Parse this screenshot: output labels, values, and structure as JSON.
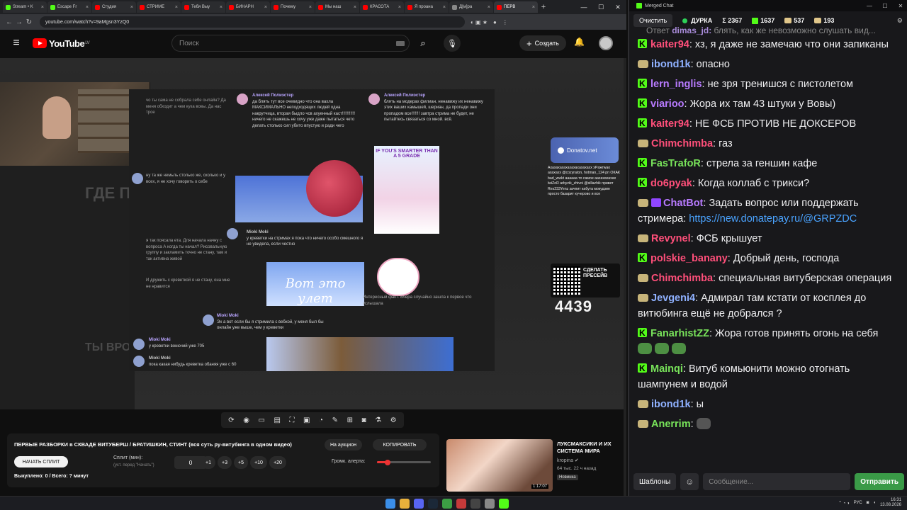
{
  "browser": {
    "tabs": [
      {
        "label": "Stream • K",
        "color": "#53fc18"
      },
      {
        "label": "Escape Fr",
        "color": "#53fc18"
      },
      {
        "label": "Студия",
        "color": "#ff0000"
      },
      {
        "label": "СТРИМЕ",
        "color": "#ff0000"
      },
      {
        "label": "Тебя Выу",
        "color": "#ff0000"
      },
      {
        "label": "БИНАРН",
        "color": "#ff0000"
      },
      {
        "label": "Почему",
        "color": "#ff0000"
      },
      {
        "label": "Мы наш",
        "color": "#ff0000"
      },
      {
        "label": "КРАСОТА",
        "color": "#ff0000"
      },
      {
        "label": "Я проана",
        "color": "#ff0000"
      },
      {
        "label": "Д[м]ра",
        "color": "#888888"
      },
      {
        "label": "ПЕРВ",
        "color": "#ff0000"
      }
    ],
    "url": "youtube.com/watch?v=9aMgsn3YzQ0"
  },
  "youtube": {
    "logo": "YouTube",
    "region": "LV",
    "search_placeholder": "Поиск",
    "create_label": "Создать"
  },
  "video": {
    "screen_msgs": {
      "name1": "Алексей Полиэстер",
      "msg1": "да блять тут все очевидно что она вахла МАКСИМАЛЬНО неподходящих людей одна накрутчица, вторая быдло чсв ахуенный каст!!!!!!!!!!! ничего не скажешь не хочу уже даже пытаться чето делать столько сил убито впустую и ради чего",
      "name2": "Алексей Полиэстер",
      "msg2": "блять на модерах филиан, ненавижу их ненавижу этих ваших камышей, шериан, да пропади они пропадом все!!!!!!! завтра стрима не будет, не пытайтесь связаться со мной. всё.",
      "name3": "Mioki Moki",
      "msg3": "у креветки на стримах я пока что ничего особо смешного я не увидела, если честно",
      "name4": "Mioki Moki",
      "msg4": "Эх а вот если бы я стримила с вебкой, у меня был бы онлайн уже выше, чем у креветки",
      "name5": "Mioki Moki",
      "msg5": "у креветки вонючий уже 705",
      "name6": "Mioki Moki",
      "msg6": "пока какая нибудь креветка обаняя уже с 60",
      "meme": "Вот это улет",
      "poster": "IF YOU'S SMARTER THAN A 5 GRADE"
    },
    "bg_text1": "ГДЕ ПАРЕ",
    "bg_text2": "ТЫ ВРОДИ",
    "donate_label": "Donatov.net",
    "alerts": "Ахахахахахахахахахахахх хPaжгwaо ахахахх @cozyraton, hotman_124 рп ОКАК bad_wwkt аааааа то самое аахахахахах lwiZoR arbyzik_zhivoi @sillazhik привет Res233Yenz зачпит кабута мокудзин просто базарит кучерово и все",
    "qr_text": "СДЕЛАТЬ ПРЕСЕЙВ",
    "counter": "4439"
  },
  "panel": {
    "title": "ПЕРВЫЕ РАЗБОРКИ в СКВАДЕ ВИТУБЕРШ / БРАТИШКИН, СТИНТ (вся суть ру-витубинга в одном видео)",
    "auction_btn": "На аукцион",
    "copy_btn": "КОПИРОВАТЬ",
    "start_btn": "НАЧАТЬ СПЛИТ",
    "split_label": "Сплит (мин):",
    "split_hint": "(уст. перед \"Начать\")",
    "split_value": "0",
    "increments": [
      "+1",
      "+3",
      "+5",
      "+10",
      "+20"
    ],
    "volume_label": "Громк. алерта:",
    "volume_level": 0.2,
    "bought": "Выкуплено: 0 / Всего: ? минут"
  },
  "recommend": {
    "title": "ЛУКСМАКСИКИ И ИХ СИСТЕМА МИРА",
    "channel": "kropina",
    "meta": "64 тыс.  22 ч назад",
    "badge": "Новинка",
    "duration": "1:17:07"
  },
  "chat": {
    "window_title": "Merged Chat",
    "clear": "Очистить",
    "stats": {
      "status": "ДУРКА",
      "sum": "Σ 2367",
      "kick": "1637",
      "twitch": "537",
      "other": "193"
    },
    "reply_prefix": "Ответ",
    "reply_user": "dimas_jd:",
    "reply_text": "блять, как же невозможно слушать вид...",
    "messages": [
      {
        "src": "kick",
        "user": "kaiter94",
        "color": "#ff4f7a",
        "text": "хз, я даже не замечаю что они запиканы"
      },
      {
        "src": "tw",
        "user": "ibond1k",
        "color": "#8fb1ff",
        "text": "опасно"
      },
      {
        "src": "kick",
        "user": "lern_inglis",
        "color": "#b87bff",
        "text": "не зря тренишся с пистолетом"
      },
      {
        "src": "kick",
        "user": "viarioo",
        "color": "#b87bff",
        "text": "Жора их там 43 штуки у Вовы)"
      },
      {
        "src": "kick",
        "user": "kaiter94",
        "color": "#ff4f7a",
        "text": "НЕ ФСБ ПРОТИВ НЕ ДОКСЕРОВ"
      },
      {
        "src": "tw",
        "user": "Chimchimba",
        "color": "#ff4f7a",
        "text": "газ"
      },
      {
        "src": "kick",
        "user": "FasTrafoR",
        "color": "#78e35a",
        "text": "стрела за геншин кафе"
      },
      {
        "src": "kick",
        "user": "do6pyak",
        "color": "#ff4f7a",
        "text": "Когда коллаб с трикси?"
      },
      {
        "src": "bot",
        "user": "ChatBot",
        "color": "#b87bff",
        "text": "Задать вопрос или поддержать стримера: ",
        "link": "https://new.donatepay.ru/@GRPZDC"
      },
      {
        "src": "tw",
        "user": "Revynel",
        "color": "#ff4f7a",
        "text": "ФСБ крышует"
      },
      {
        "src": "kick",
        "user": "polskie_banany",
        "color": "#ff4f7a",
        "text": "Добрый день, господа"
      },
      {
        "src": "tw",
        "user": "Chimchimba",
        "color": "#ff4f7a",
        "text": "специальная витуберская операция"
      },
      {
        "src": "tw",
        "user": "Jevgeni4",
        "color": "#8fb1ff",
        "text": "Адмирал там кстати от косплея до витюбинга ещё не добрался ?"
      },
      {
        "src": "kick",
        "user": "FanarhistZZ",
        "color": "#78e35a",
        "text": "Жора готов принять огонь на себя"
      },
      {
        "src": "kick",
        "user": "Mainqi",
        "color": "#78e35a",
        "text": "Витуб комьюнити  можно отогнать шампунем и водой"
      },
      {
        "src": "tw",
        "user": "ibond1k",
        "color": "#8fb1ff",
        "text": "ы"
      },
      {
        "src": "tw",
        "user": "Anerrim",
        "color": "#78e35a",
        "text": ""
      }
    ],
    "templates": "Шаблоны",
    "input_placeholder": "Сообщение...",
    "send": "Отправить"
  },
  "taskbar": {
    "lang": "РУС",
    "time": "16:31",
    "date": "13.08.2026"
  }
}
